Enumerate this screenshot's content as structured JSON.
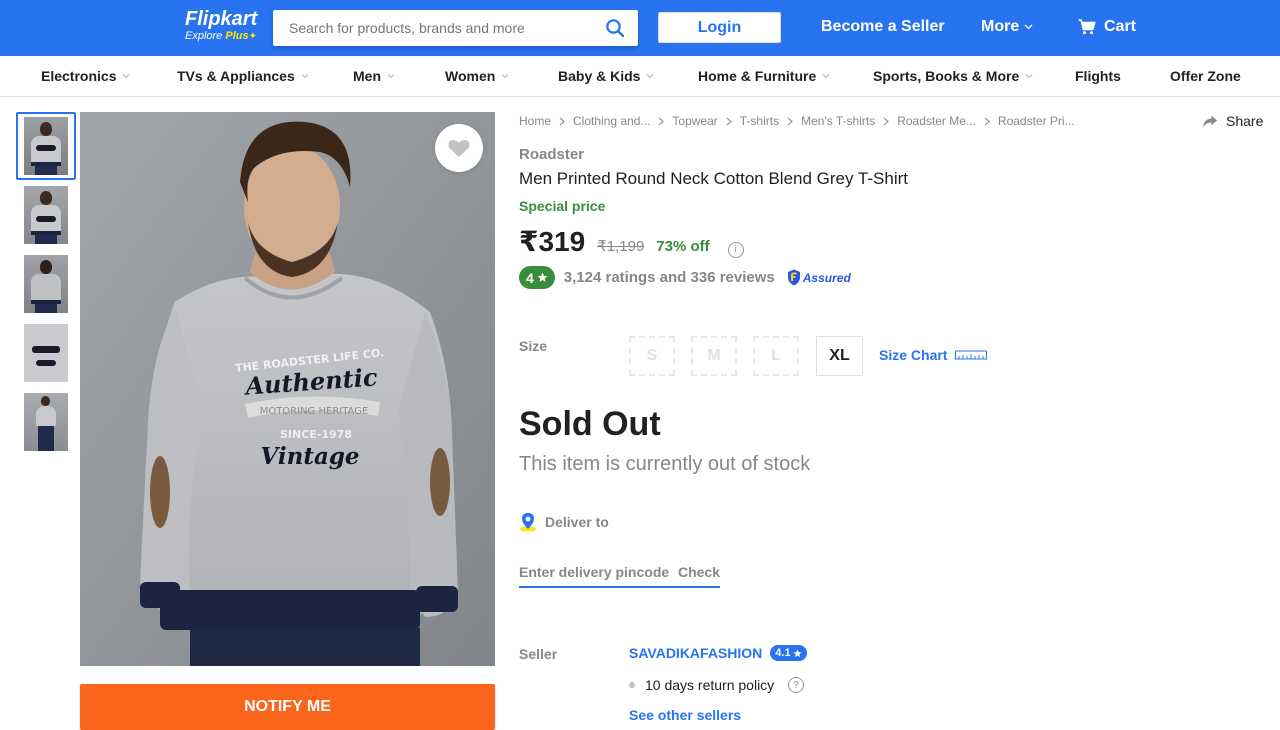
{
  "header": {
    "logo_text": "Flipkart",
    "logo_sub": "Explore",
    "logo_plus": "Plus",
    "search_placeholder": "Search for products, brands and more",
    "login_label": "Login",
    "seller_label": "Become a Seller",
    "more_label": "More",
    "cart_label": "Cart",
    "brand_color": "#2874f0"
  },
  "nav": {
    "items": [
      {
        "label": "Electronics",
        "has_dropdown": true
      },
      {
        "label": "TVs & Appliances",
        "has_dropdown": true
      },
      {
        "label": "Men",
        "has_dropdown": true
      },
      {
        "label": "Women",
        "has_dropdown": true
      },
      {
        "label": "Baby & Kids",
        "has_dropdown": true
      },
      {
        "label": "Home & Furniture",
        "has_dropdown": true
      },
      {
        "label": "Sports, Books & More",
        "has_dropdown": true
      },
      {
        "label": "Flights",
        "has_dropdown": false
      },
      {
        "label": "Offer Zone",
        "has_dropdown": false
      }
    ]
  },
  "gallery": {
    "thumb_count": 5,
    "active_index": 0,
    "notify_label": "NOTIFY ME",
    "print_lines": [
      "THE ROADSTER LIFE CO.",
      "Authentic",
      "MOTORING HERITAGE",
      "SINCE-1978",
      "Vintage"
    ]
  },
  "breadcrumbs": [
    "Home",
    "Clothing and...",
    "Topwear",
    "T-shirts",
    "Men's T-shirts",
    "Roadster Me...",
    "Roadster Pri..."
  ],
  "share_label": "Share",
  "product": {
    "brand": "Roadster",
    "title": "Men Printed Round Neck Cotton Blend Grey T-Shirt",
    "special_label": "Special price",
    "price": "₹319",
    "mrp": "₹1,199",
    "discount": "73% off",
    "rating": "4",
    "ratings_text": "3,124 ratings and 336 reviews",
    "assured_label": "Assured"
  },
  "size": {
    "label": "Size",
    "options": [
      {
        "label": "S",
        "available": false
      },
      {
        "label": "M",
        "available": false
      },
      {
        "label": "L",
        "available": false
      },
      {
        "label": "XL",
        "available": true
      }
    ],
    "chart_label": "Size Chart"
  },
  "stock": {
    "status": "Sold Out",
    "message": "This item is currently out of stock"
  },
  "delivery": {
    "label": "Deliver to",
    "pincode_placeholder": "Enter delivery pincode",
    "check_label": "Check"
  },
  "seller": {
    "label": "Seller",
    "name": "SAVADIKAFASHION",
    "rating": "4.1",
    "return_policy": "10 days return policy",
    "other_sellers": "See other sellers"
  }
}
